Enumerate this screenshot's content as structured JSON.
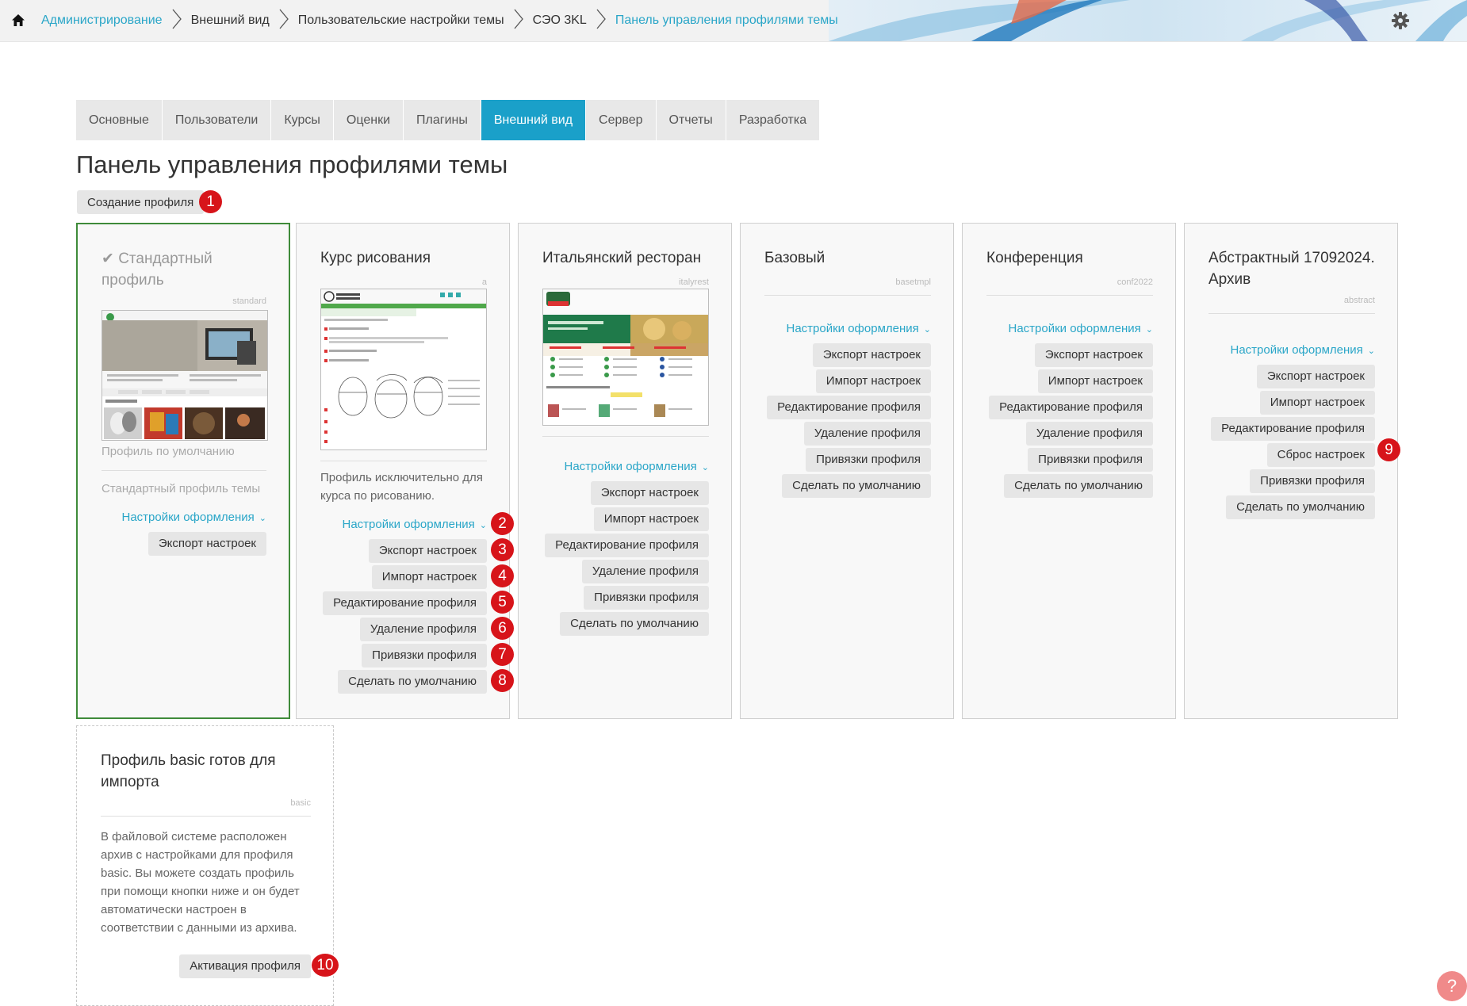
{
  "breadcrumb": {
    "items": [
      {
        "label": "Администрирование"
      },
      {
        "label": "Внешний вид"
      },
      {
        "label": "Пользовательские настройки темы"
      },
      {
        "label": "СЭО 3KL"
      },
      {
        "label": "Панель управления профилями темы"
      }
    ]
  },
  "tabs": [
    {
      "label": "Основные"
    },
    {
      "label": "Пользователи"
    },
    {
      "label": "Курсы"
    },
    {
      "label": "Оценки"
    },
    {
      "label": "Плагины"
    },
    {
      "label": "Внешний вид",
      "active": true
    },
    {
      "label": "Сервер"
    },
    {
      "label": "Отчеты"
    },
    {
      "label": "Разработка"
    }
  ],
  "page": {
    "title": "Панель управления профилями темы",
    "create_button": "Создание профиля"
  },
  "markers": [
    "1",
    "2",
    "3",
    "4",
    "5",
    "6",
    "7",
    "8",
    "9",
    "10"
  ],
  "actions": {
    "settings": "Настройки оформления",
    "export": "Экспорт настроек",
    "import": "Импорт настроек",
    "edit": "Редактирование профиля",
    "delete": "Удаление профиля",
    "reset": "Сброс настроек",
    "bindings": "Привязки профиля",
    "default": "Сделать по умолчанию",
    "activate": "Активация профиля"
  },
  "cards": {
    "standard": {
      "check": "✔",
      "title": "Стандартный профиль",
      "code": "standard",
      "caption": "Профиль по умолчанию",
      "description": "Стандартный профиль темы"
    },
    "drawing": {
      "title": "Курс рисования",
      "code": "a",
      "description": "Профиль исключительно для курса по рисованию."
    },
    "italy": {
      "title": "Итальянский ресторан",
      "code": "italyrest"
    },
    "base": {
      "title": "Базовый",
      "code": "basetmpl"
    },
    "conf": {
      "title": "Конференция",
      "code": "conf2022"
    },
    "abstract": {
      "title": "Абстрактный 17092024. Архив",
      "code": "abstract"
    },
    "basic_import": {
      "title": "Профиль basic готов для импорта",
      "code": "basic",
      "description": "В файловой системе расположен архив с настройками для профиля basic. Вы можете создать профиль при помощи кнопки ниже и он будет автоматически настроен в соответствии с данными из архива."
    }
  },
  "help": "?",
  "colors": {
    "accent": "#1aa0c9",
    "link": "#2aa6c8",
    "current_border": "#3f8b3a",
    "marker": "#d7141a"
  }
}
